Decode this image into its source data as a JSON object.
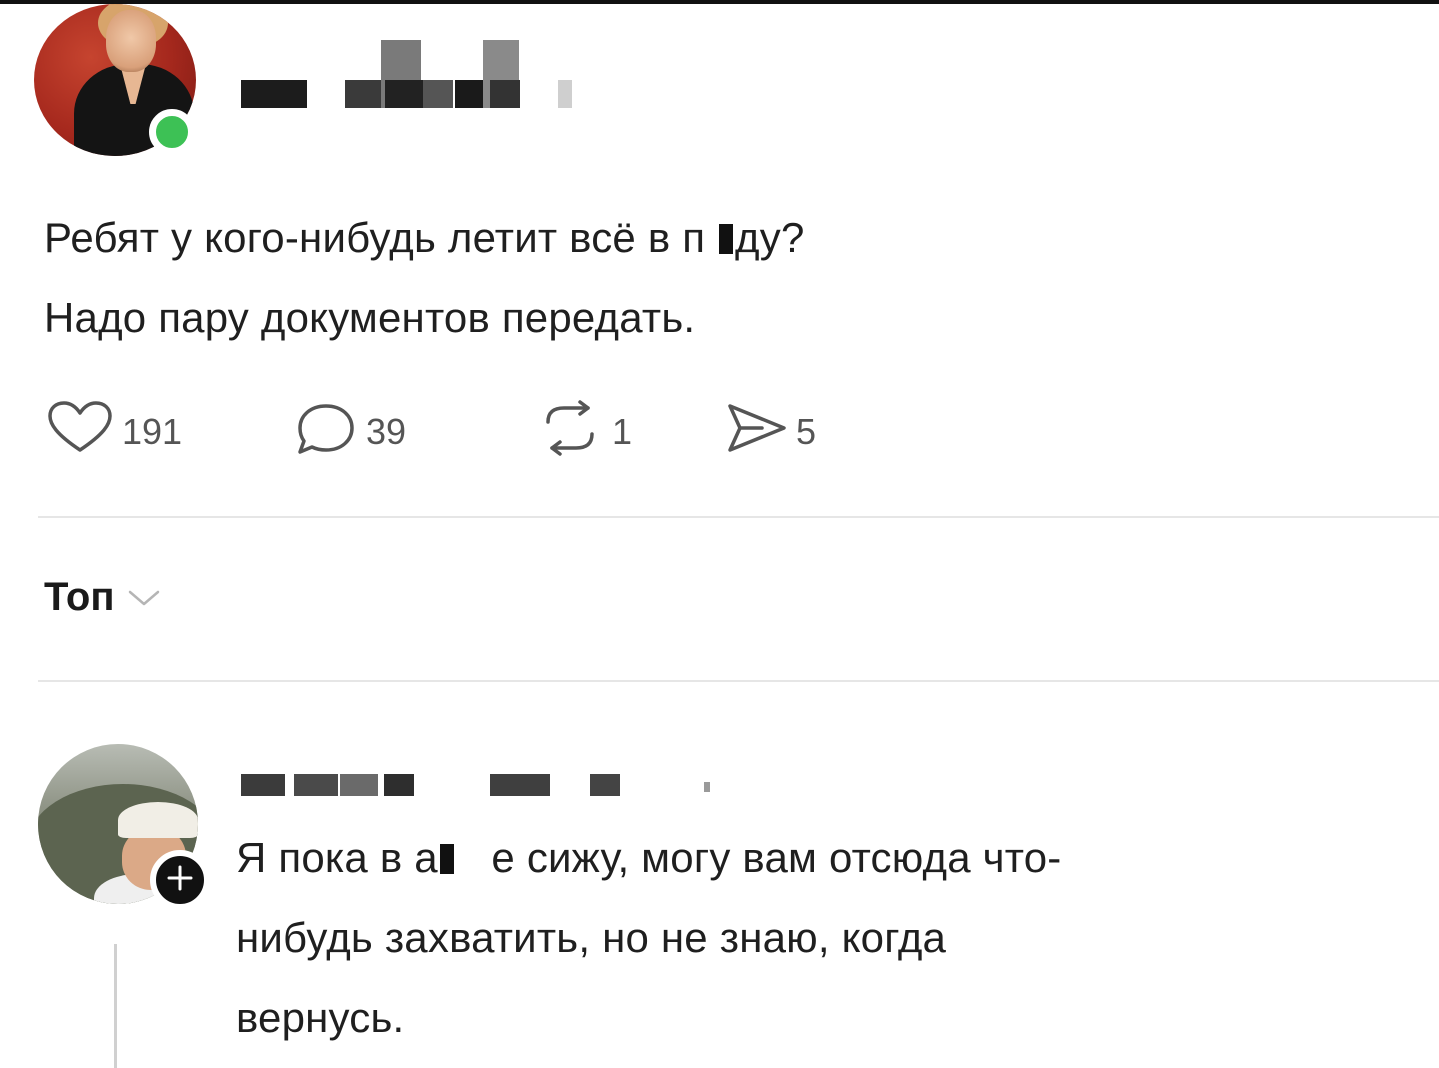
{
  "post": {
    "avatar_icon": "user-avatar-photo",
    "online_status": "online",
    "online_color": "#3dc155",
    "text_line_1": "Ребят у кого-нибудь летит всё в п",
    "text_line_1_tail": "ду?",
    "text_line_2": "Надо пару документов передать.",
    "actions": {
      "likes": "191",
      "replies": "39",
      "reposts": "1",
      "shares": "5"
    }
  },
  "comments_sort": {
    "label": "Топ",
    "icon": "chevron-down-icon"
  },
  "comment": {
    "avatar_icon": "user-avatar-photo",
    "follow_icon": "plus-icon",
    "text_line_1_start": "Я пока в а",
    "text_line_1_end": "е сижу, могу вам отсюда что-",
    "text_line_2": "нибудь захватить, но не знаю, когда",
    "text_line_3": "вернусь."
  }
}
